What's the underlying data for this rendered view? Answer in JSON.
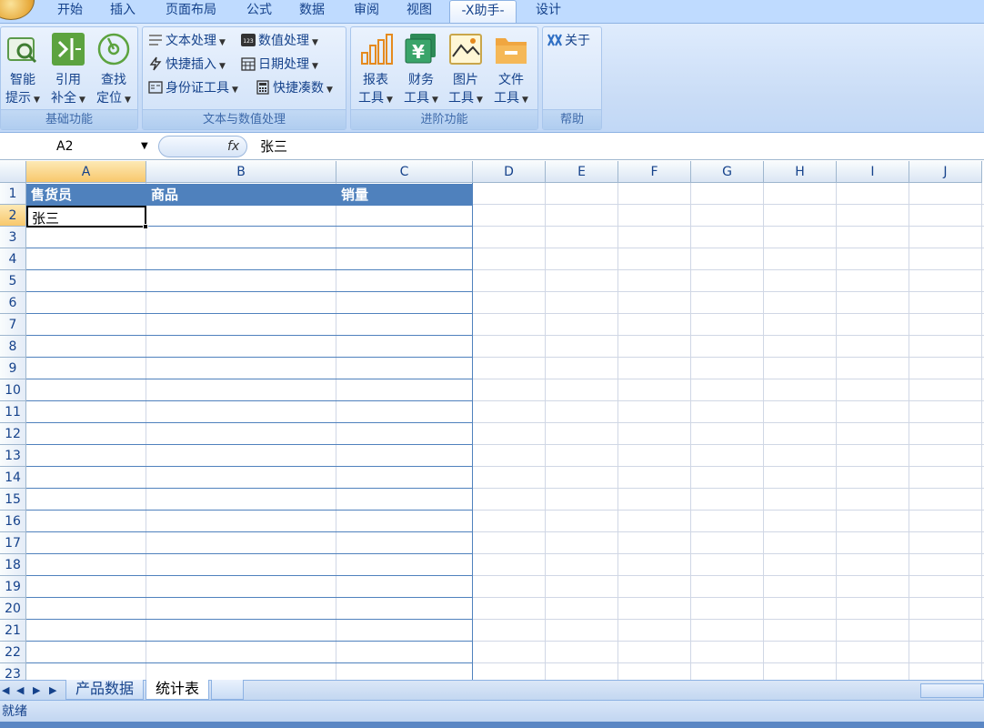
{
  "ribbon_tabs": [
    "开始",
    "插入",
    "页面布局",
    "公式",
    "数据",
    "审阅",
    "视图",
    "-X助手-",
    "设计"
  ],
  "active_tab": "-X助手-",
  "groups": {
    "basic": {
      "title": "基础功能",
      "buttons": [
        {
          "line1": "智能",
          "line2": "提示",
          "icon": "magnifier-icon"
        },
        {
          "line1": "引用",
          "line2": "补全",
          "icon": "reference-icon"
        },
        {
          "line1": "查找",
          "line2": "定位",
          "icon": "target-icon"
        }
      ]
    },
    "text": {
      "title": "文本与数值处理",
      "items": [
        {
          "label": "文本处理",
          "icon": "text-lines-icon"
        },
        {
          "label": "数值处理",
          "icon": "number-123-icon"
        },
        {
          "label": "快捷插入",
          "icon": "lightning-icon"
        },
        {
          "label": "日期处理",
          "icon": "calendar-icon"
        },
        {
          "label": "身份证工具",
          "icon": "id-card-icon"
        },
        {
          "label": "快捷凑数",
          "icon": "calculator-icon"
        }
      ]
    },
    "advanced": {
      "title": "进阶功能",
      "buttons": [
        {
          "line1": "报表",
          "line2": "工具",
          "icon": "bar-chart-icon"
        },
        {
          "line1": "财务",
          "line2": "工具",
          "icon": "yuan-icon"
        },
        {
          "line1": "图片",
          "line2": "工具",
          "icon": "picture-icon"
        },
        {
          "line1": "文件",
          "line2": "工具",
          "icon": "folder-icon"
        }
      ]
    },
    "help": {
      "title": "帮助",
      "about": "关于"
    }
  },
  "formula_bar": {
    "name_box": "A2",
    "fx": "fx",
    "value": "张三"
  },
  "columns": [
    "A",
    "B",
    "C",
    "D",
    "E",
    "F",
    "G",
    "H",
    "I",
    "J"
  ],
  "rows": [
    "1",
    "2",
    "3",
    "4",
    "5",
    "6",
    "7",
    "8",
    "9",
    "10",
    "11",
    "12",
    "13",
    "14",
    "15",
    "16",
    "17",
    "18",
    "19",
    "20",
    "21",
    "22",
    "23"
  ],
  "table": {
    "headers": [
      "售货员",
      "商品",
      "销量"
    ],
    "a2": "张三"
  },
  "sheets": [
    "产品数据",
    "统计表"
  ],
  "active_sheet": "统计表",
  "status": "就绪",
  "colors": {
    "table_header": "#4f81bd",
    "selection": "#f8c86c"
  }
}
